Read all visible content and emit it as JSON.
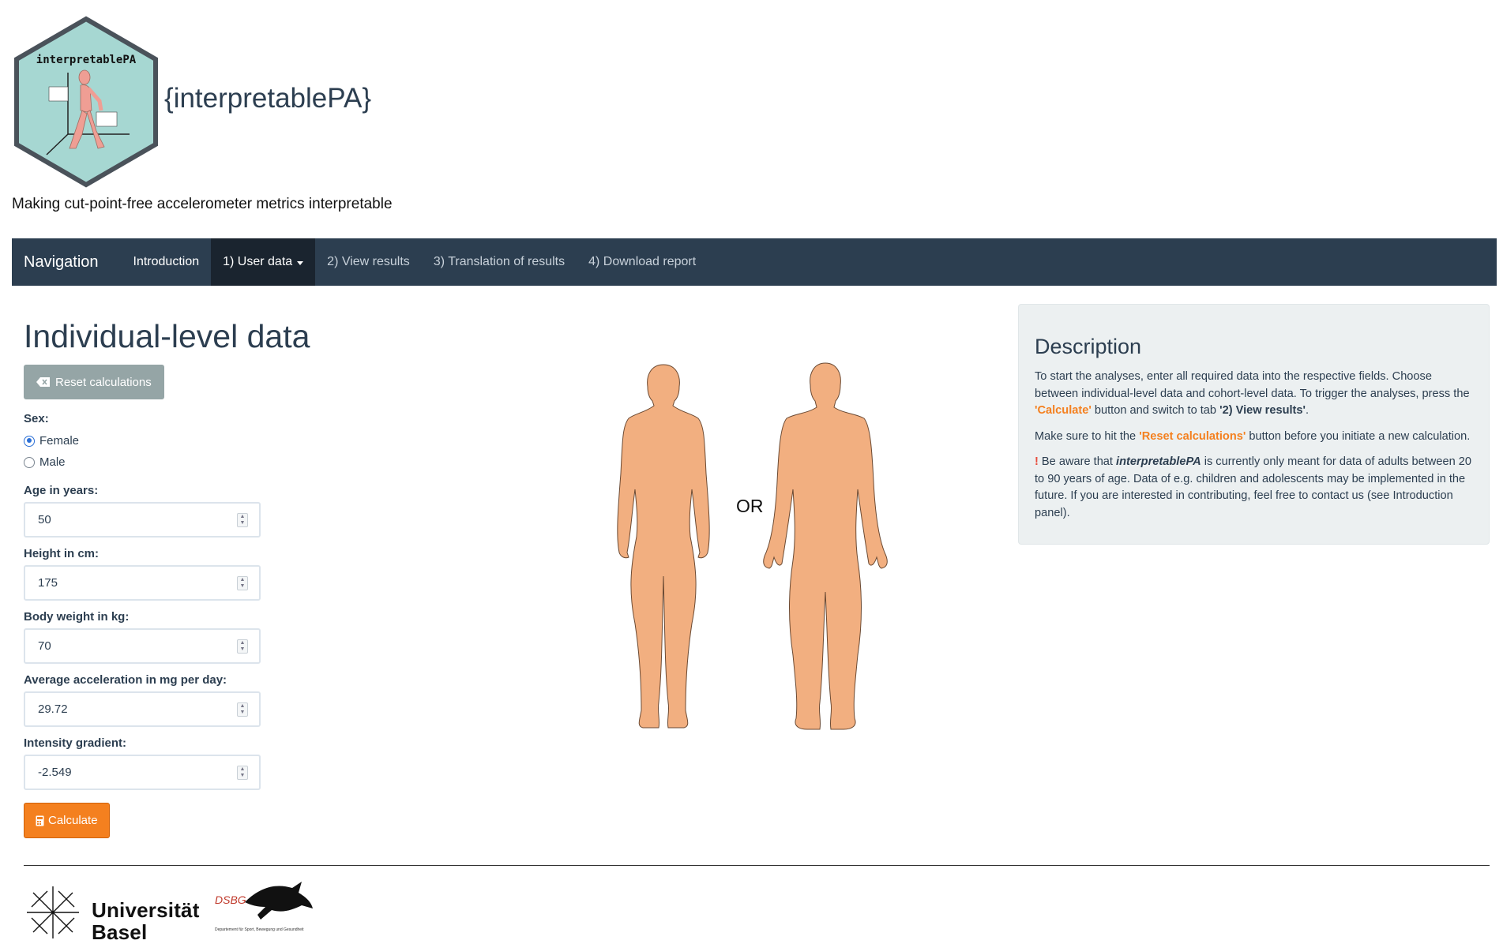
{
  "header": {
    "logo_text": "interpretablePA",
    "app_title": "{interpretablePA}",
    "tagline": "Making cut-point-free accelerometer metrics interpretable"
  },
  "navbar": {
    "brand": "Navigation",
    "items": [
      {
        "label": "Introduction"
      },
      {
        "label": "1) User data"
      },
      {
        "label": "2) View results"
      },
      {
        "label": "3) Translation of results"
      },
      {
        "label": "4) Download report"
      }
    ]
  },
  "form": {
    "title": "Individual-level data",
    "reset_label": "Reset calculations",
    "sex_label": "Sex:",
    "sex_options": [
      "Female",
      "Male"
    ],
    "sex_selected": "Female",
    "age_label": "Age in years:",
    "age_value": "50",
    "height_label": "Height in cm:",
    "height_value": "175",
    "weight_label": "Body weight in kg:",
    "weight_value": "70",
    "accel_label": "Average acceleration in mg per day:",
    "accel_value": "29.72",
    "ig_label": "Intensity gradient:",
    "ig_value": "-2.549",
    "calc_label": "Calculate"
  },
  "figure": {
    "or_text": "OR",
    "skin_color": "#f2af80"
  },
  "description": {
    "title": "Description",
    "p1_a": "To start the analyses, enter all required data into the respective fields. Choose between individual-level data and cohort-level data. To trigger the analyses, press the ",
    "p1_calc": "'Calculate'",
    "p1_b": " button and switch to tab ",
    "p1_tab": "'2) View results'",
    "p1_c": ".",
    "p2_a": "Make sure to hit the ",
    "p2_reset": "'Reset calculations'",
    "p2_b": " button before you initiate a new calculation.",
    "p3_mark": "!",
    "p3_a": " Be aware that ",
    "p3_pkg": "interpretablePA",
    "p3_b": " is currently only meant for data of adults between 20 to 90 years of age. Data of e.g. children and adolescents may be implemented in the future. If you are interested in contributing, feel free to contact us (see Introduction panel)."
  },
  "footer": {
    "uni_line1": "Universität",
    "uni_line2": "Basel",
    "dsbg": "DSBG",
    "dsbg_sub": "Departement für Sport, Bewegung und Gesundheit"
  },
  "colors": {
    "navbar": "#2c3e50",
    "accent_orange": "#f4801f",
    "reset_gray": "#95a5a6",
    "panel_bg": "#ecf0f1"
  }
}
